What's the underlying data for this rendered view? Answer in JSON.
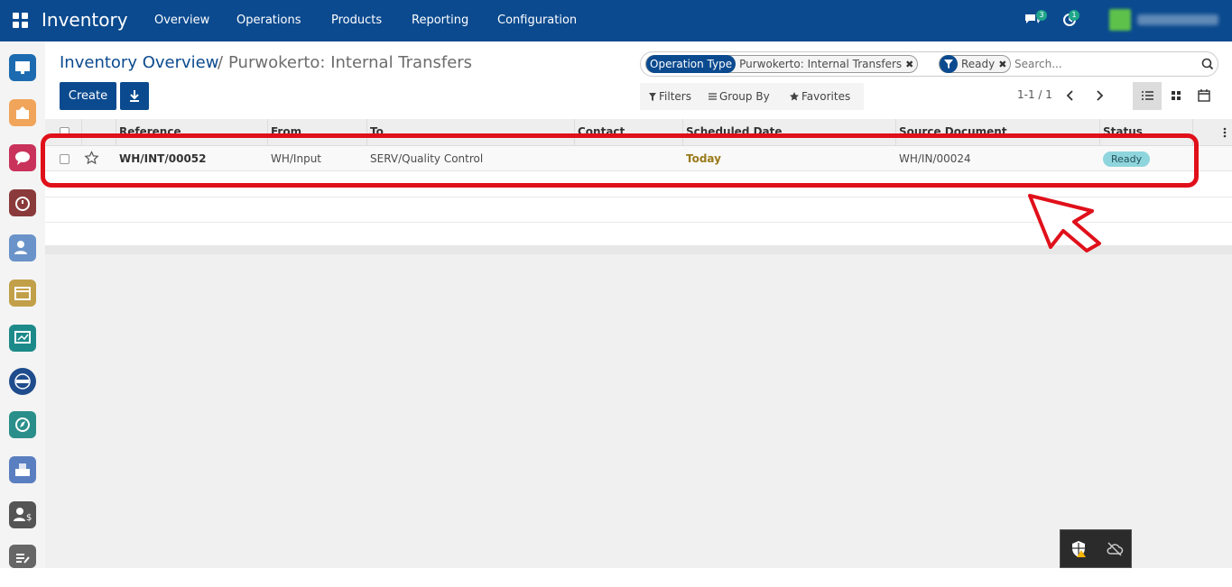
{
  "topbar": {
    "brand": "Inventory",
    "menu": [
      "Overview",
      "Operations",
      "Products",
      "Reporting",
      "Configuration"
    ],
    "messages_count": "3",
    "activities_count": "1"
  },
  "breadcrumb": {
    "root": "Inventory Overview",
    "separator": "/",
    "current": "Purwokerto: Internal Transfers"
  },
  "buttons": {
    "create": "Create"
  },
  "search": {
    "facets": [
      {
        "label": "Operation Type",
        "value": "Purwokerto: Internal Transfers"
      },
      {
        "value": "Ready"
      }
    ],
    "placeholder": "Search..."
  },
  "filters": {
    "filters_label": "Filters",
    "group_by_label": "Group By",
    "favorites_label": "Favorites"
  },
  "pager": {
    "value": "1-1 / 1"
  },
  "table": {
    "columns": [
      "Reference",
      "From",
      "To",
      "Contact",
      "Scheduled Date",
      "Source Document",
      "Status"
    ],
    "rows": [
      {
        "reference": "WH/INT/00052",
        "from": "WH/Input",
        "to": "SERV/Quality Control",
        "contact": "",
        "scheduled_date": "Today",
        "source_document": "WH/IN/00024",
        "status": "Ready"
      }
    ]
  },
  "colors": {
    "brand": "#0b4a8f",
    "highlight": "#e0101a",
    "status_ready": "#8fd5dd",
    "today": "#9a7a1a"
  }
}
